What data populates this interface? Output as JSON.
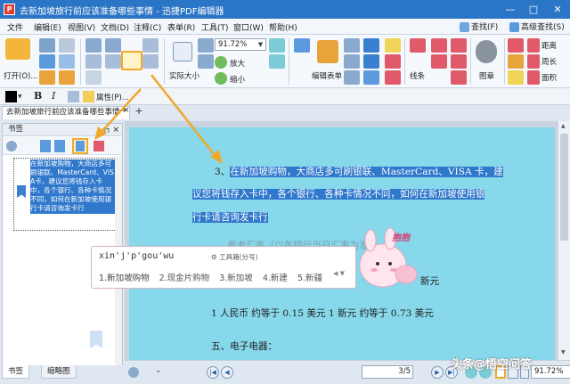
{
  "window": {
    "app_icon_letter": "P",
    "title": "去新加坡旅行前应该准备哪些事情 - 迅捷PDF编辑器",
    "min_glyph": "—",
    "max_glyph": "□",
    "close_glyph": "✕"
  },
  "menu": {
    "items": [
      "文件",
      "编辑(E)",
      "视图(V)",
      "文档(D)",
      "注释(C)",
      "表单(R)",
      "工具(T)",
      "窗口(W)",
      "帮助(H)"
    ],
    "find": "查找(F)",
    "advanced_find": "高级查找(S)"
  },
  "ribbon": {
    "open_label": "打开(O)...",
    "zoom_value": "91.72%",
    "actual_size": "实际大小",
    "zoom_in": "放大",
    "zoom_out": "缩小",
    "edit_form": "编辑表单",
    "lines": "线条",
    "stamp": "图章",
    "distance": "距离",
    "perimeter": "周长",
    "area": "面积"
  },
  "format": {
    "bold": "B",
    "italic": "I",
    "properties": "属性(P)..."
  },
  "tabs": {
    "doc_tab": "去新加坡旅行前应该准备哪些事情 *",
    "close": "×",
    "add": "+"
  },
  "left_panel": {
    "title": "书签",
    "pin": "⊓",
    "close": "×",
    "bookmark_text": "在新加坡购物，大商店多可刷银联、MasterCard、VISA卡，建议您将钱存入卡中，各个银行、各种卡情况不同，如何在新加坡使用银行卡请咨询发卡行",
    "tab_bookmarks": "书签",
    "tab_thumbnails": "缩略图"
  },
  "document": {
    "line1_prefix": "3、",
    "line1_hl": "在新加坡购物，大商店多可刷银联、MasterCard、VISA 卡，建",
    "line2_hl": "议您将钱存入卡中，各个银行、各种卡情况不同，如何在新加坡使用银",
    "line3_hl": "行卡请咨询发卡行",
    "line4": "参考汇率（以各银行当日汇率为准）",
    "line5_suffix": "新元",
    "line6": "1 人民币  约等于  0.15  美元  1 新元  约等于  0.73  美元",
    "line7": "五、电子电器："
  },
  "ime": {
    "pinyin": "xin'j'p'gou'wu",
    "toolbox": "工具箱(分号)",
    "candidates": [
      "1.新加坡购物",
      "2.现金片购物",
      "3.新加坡",
      "4.新建",
      "5.新疆"
    ],
    "mascot_text": "抱抱"
  },
  "statusbar": {
    "page_value": "3",
    "page_total": "/5",
    "zoom": "91.72%"
  },
  "watermark": "头条@悟空问答",
  "colors": {
    "title_bar": "#2b75c6",
    "page_bg": "#86d8ea",
    "highlight": "#2f78cc",
    "callout": "#f0a92a"
  }
}
